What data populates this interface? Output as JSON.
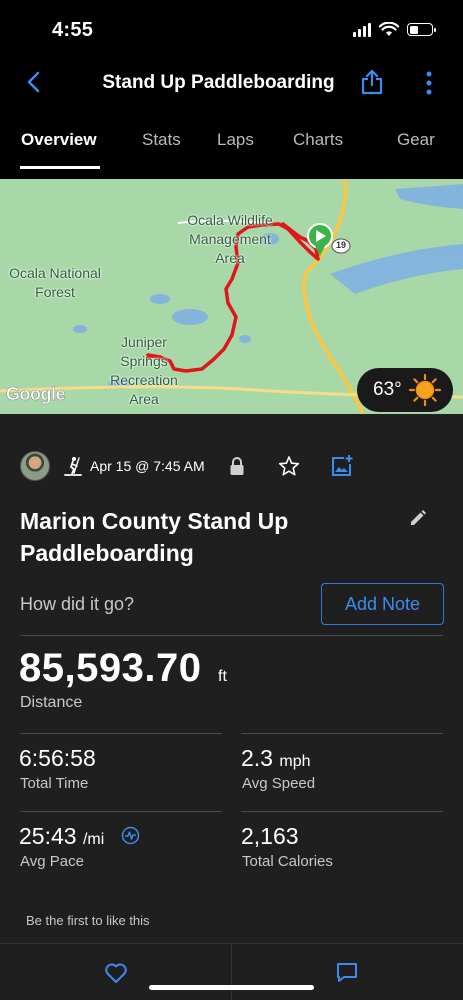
{
  "status_bar": {
    "time": "4:55"
  },
  "nav": {
    "title": "Stand Up Paddleboarding"
  },
  "tabs": [
    {
      "label": "Overview",
      "active": true
    },
    {
      "label": "Stats"
    },
    {
      "label": "Laps"
    },
    {
      "label": "Charts"
    },
    {
      "label": "Gear"
    }
  ],
  "map": {
    "labels": {
      "ocala_wildlife": "Ocala Wildlife Management Area",
      "ocala_national": "Ocala National Forest",
      "juniper": "Juniper Springs Recreation Area"
    },
    "route_shield": "19",
    "google_text": "Google",
    "weather_temp": "63°",
    "colors": {
      "route": "#e0161b",
      "land": "#a8d7a8",
      "water": "#7fb1e2",
      "road": "#f5c84a"
    }
  },
  "activity": {
    "date": "Apr 15 @ 7:45 AM",
    "title": "Marion County Stand Up Paddleboarding",
    "how_text": "How did it go?",
    "add_note_label": "Add Note"
  },
  "stats": {
    "distance": {
      "value": "85,593.70",
      "unit": "ft",
      "label": "Distance"
    },
    "total_time": {
      "value": "6:56:58",
      "label": "Total Time"
    },
    "avg_speed": {
      "value": "2.3",
      "unit": "mph",
      "label": "Avg Speed"
    },
    "avg_pace": {
      "value": "25:43",
      "unit": "/mi",
      "label": "Avg Pace"
    },
    "total_calories": {
      "value": "2,163",
      "label": "Total Calories"
    }
  },
  "social": {
    "like_text": "Be the first to like this"
  },
  "accent_color": "#2b7bd8"
}
